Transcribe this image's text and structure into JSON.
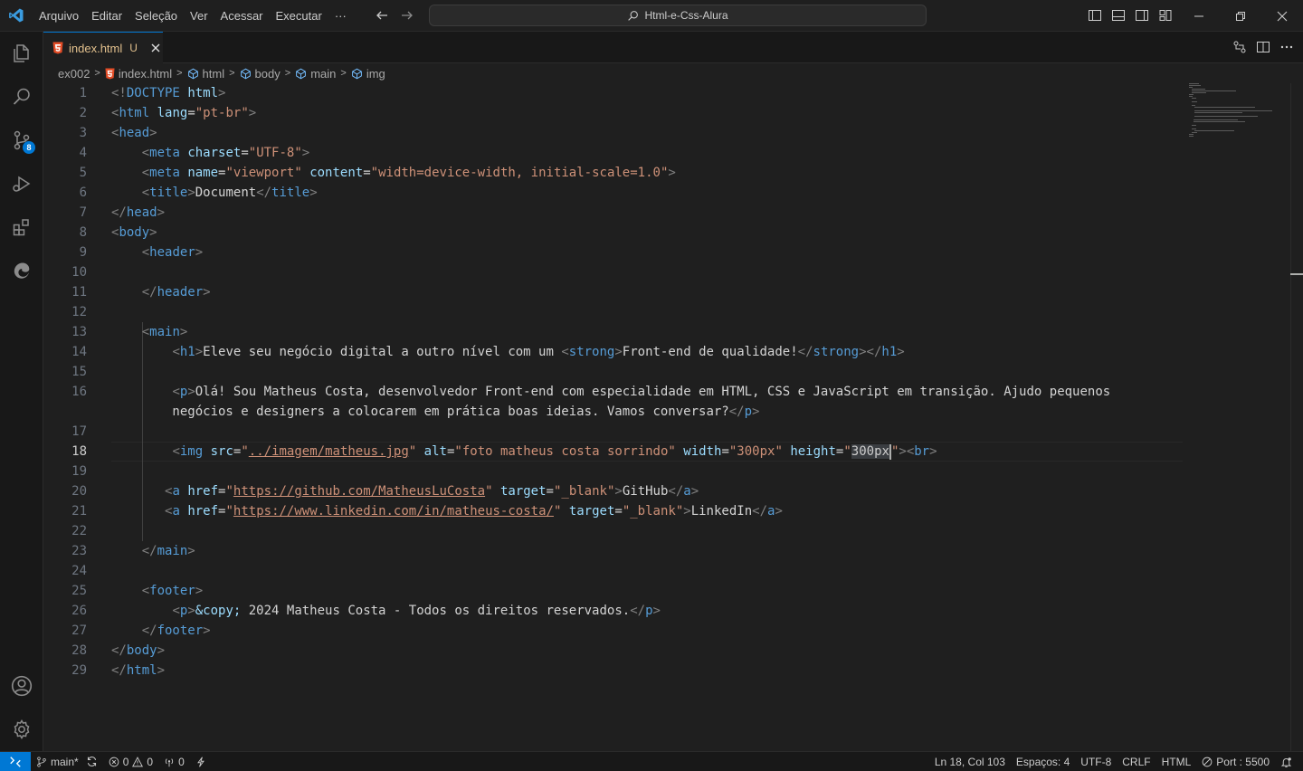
{
  "title_bar": {
    "menu": [
      "Arquivo",
      "Editar",
      "Seleção",
      "Ver",
      "Acessar",
      "Executar"
    ],
    "more": "···",
    "search_text": "Html-e-Css-Alura"
  },
  "activity_bar": {
    "items": [
      "explorer-icon",
      "search-icon",
      "source-control-icon",
      "run-debug-icon",
      "extensions-icon",
      "edge-devtools-icon"
    ],
    "source_control_badge": "8",
    "bottom": [
      "account-icon",
      "settings-icon"
    ]
  },
  "tab": {
    "filename": "index.html",
    "status": "U",
    "icon": "html5-icon"
  },
  "breadcrumb": {
    "items": [
      "ex002",
      "index.html",
      "html",
      "body",
      "main",
      "img"
    ]
  },
  "editor": {
    "active_line": 18,
    "line_numbers": [
      "1",
      "2",
      "3",
      "4",
      "5",
      "6",
      "7",
      "8",
      "9",
      "10",
      "11",
      "12",
      "13",
      "14",
      "15",
      "16",
      "",
      "17",
      "18",
      "19",
      "20",
      "21",
      "22",
      "23",
      "24",
      "25",
      "26",
      "27",
      "28",
      "29"
    ],
    "lines": [
      [
        [
          "t",
          "<!"
        ],
        [
          "tg",
          "DOCTYPE"
        ],
        [
          "tx",
          " "
        ],
        [
          "at",
          "html"
        ],
        [
          "t",
          ">"
        ]
      ],
      [
        [
          "t",
          "<"
        ],
        [
          "tg",
          "html"
        ],
        [
          "tx",
          " "
        ],
        [
          "at",
          "lang"
        ],
        [
          "tx",
          "="
        ],
        [
          "sv",
          "\"pt-br\""
        ],
        [
          "t",
          ">"
        ]
      ],
      [
        [
          "t",
          "<"
        ],
        [
          "tg",
          "head"
        ],
        [
          "t",
          ">"
        ]
      ],
      [
        [
          "tx",
          "    "
        ],
        [
          "t",
          "<"
        ],
        [
          "tg",
          "meta"
        ],
        [
          "tx",
          " "
        ],
        [
          "at",
          "charset"
        ],
        [
          "tx",
          "="
        ],
        [
          "sv",
          "\"UTF-8\""
        ],
        [
          "t",
          ">"
        ]
      ],
      [
        [
          "tx",
          "    "
        ],
        [
          "t",
          "<"
        ],
        [
          "tg",
          "meta"
        ],
        [
          "tx",
          " "
        ],
        [
          "at",
          "name"
        ],
        [
          "tx",
          "="
        ],
        [
          "sv",
          "\"viewport\""
        ],
        [
          "tx",
          " "
        ],
        [
          "at",
          "content"
        ],
        [
          "tx",
          "="
        ],
        [
          "sv",
          "\"width=device-width, initial-scale=1.0\""
        ],
        [
          "t",
          ">"
        ]
      ],
      [
        [
          "tx",
          "    "
        ],
        [
          "t",
          "<"
        ],
        [
          "tg",
          "title"
        ],
        [
          "t",
          ">"
        ],
        [
          "tx",
          "Document"
        ],
        [
          "t",
          "</"
        ],
        [
          "tg",
          "title"
        ],
        [
          "t",
          ">"
        ]
      ],
      [
        [
          "t",
          "</"
        ],
        [
          "tg",
          "head"
        ],
        [
          "t",
          ">"
        ]
      ],
      [
        [
          "t",
          "<"
        ],
        [
          "tg",
          "body"
        ],
        [
          "t",
          ">"
        ]
      ],
      [
        [
          "tx",
          "    "
        ],
        [
          "t",
          "<"
        ],
        [
          "tg",
          "header"
        ],
        [
          "t",
          ">"
        ]
      ],
      [],
      [
        [
          "tx",
          "    "
        ],
        [
          "t",
          "</"
        ],
        [
          "tg",
          "header"
        ],
        [
          "t",
          ">"
        ]
      ],
      [],
      [
        [
          "tx",
          "    "
        ],
        [
          "t",
          "<"
        ],
        [
          "tg",
          "main"
        ],
        [
          "t",
          ">"
        ]
      ],
      [
        [
          "tx",
          "        "
        ],
        [
          "t",
          "<"
        ],
        [
          "tg",
          "h1"
        ],
        [
          "t",
          ">"
        ],
        [
          "tx",
          "Eleve seu negócio digital a outro nível com um "
        ],
        [
          "t",
          "<"
        ],
        [
          "tg",
          "strong"
        ],
        [
          "t",
          ">"
        ],
        [
          "tx",
          "Front-end de qualidade!"
        ],
        [
          "t",
          "</"
        ],
        [
          "tg",
          "strong"
        ],
        [
          "t",
          "></"
        ],
        [
          "tg",
          "h1"
        ],
        [
          "t",
          ">"
        ]
      ],
      [],
      [
        [
          "tx",
          "        "
        ],
        [
          "t",
          "<"
        ],
        [
          "tg",
          "p"
        ],
        [
          "t",
          ">"
        ],
        [
          "tx",
          "Olá! Sou Matheus Costa, desenvolvedor Front-end com especialidade em HTML, CSS e JavaScript em transição. Ajudo pequenos"
        ]
      ],
      [
        [
          "tx",
          "        negócios e designers a colocarem em prática boas ideias. Vamos conversar?"
        ],
        [
          "t",
          "</"
        ],
        [
          "tg",
          "p"
        ],
        [
          "t",
          ">"
        ]
      ],
      [],
      [
        [
          "tx",
          "        "
        ],
        [
          "t",
          "<"
        ],
        [
          "tg",
          "img"
        ],
        [
          "tx",
          " "
        ],
        [
          "at",
          "src"
        ],
        [
          "tx",
          "="
        ],
        [
          "sv",
          "\""
        ],
        [
          "lk",
          "../imagem/matheus.jpg"
        ],
        [
          "sv",
          "\""
        ],
        [
          "tx",
          " "
        ],
        [
          "at",
          "alt"
        ],
        [
          "tx",
          "="
        ],
        [
          "sv",
          "\"foto matheus costa sorrindo\""
        ],
        [
          "tx",
          " "
        ],
        [
          "at",
          "width"
        ],
        [
          "tx",
          "="
        ],
        [
          "sv",
          "\"300px\""
        ],
        [
          "tx",
          " "
        ],
        [
          "at",
          "height"
        ],
        [
          "tx",
          "="
        ],
        [
          "sv",
          "\""
        ],
        [
          "sel",
          "300px"
        ],
        [
          "caret",
          ""
        ],
        [
          "sv",
          "\""
        ],
        [
          "t",
          ">"
        ],
        [
          "t",
          "<"
        ],
        [
          "tg",
          "br"
        ],
        [
          "t",
          ">"
        ]
      ],
      [],
      [
        [
          "tx",
          "       "
        ],
        [
          "t",
          "<"
        ],
        [
          "tg",
          "a"
        ],
        [
          "tx",
          " "
        ],
        [
          "at",
          "href"
        ],
        [
          "tx",
          "="
        ],
        [
          "sv",
          "\""
        ],
        [
          "lk",
          "https://github.com/MatheusLuCosta"
        ],
        [
          "sv",
          "\""
        ],
        [
          "tx",
          " "
        ],
        [
          "at",
          "target"
        ],
        [
          "tx",
          "="
        ],
        [
          "sv",
          "\"_blank\""
        ],
        [
          "t",
          ">"
        ],
        [
          "tx",
          "GitHub"
        ],
        [
          "t",
          "</"
        ],
        [
          "tg",
          "a"
        ],
        [
          "t",
          ">"
        ]
      ],
      [
        [
          "tx",
          "       "
        ],
        [
          "t",
          "<"
        ],
        [
          "tg",
          "a"
        ],
        [
          "tx",
          " "
        ],
        [
          "at",
          "href"
        ],
        [
          "tx",
          "="
        ],
        [
          "sv",
          "\""
        ],
        [
          "lk",
          "https://www.linkedin.com/in/matheus-costa/"
        ],
        [
          "sv",
          "\""
        ],
        [
          "tx",
          " "
        ],
        [
          "at",
          "target"
        ],
        [
          "tx",
          "="
        ],
        [
          "sv",
          "\"_blank\""
        ],
        [
          "t",
          ">"
        ],
        [
          "tx",
          "LinkedIn"
        ],
        [
          "t",
          "</"
        ],
        [
          "tg",
          "a"
        ],
        [
          "t",
          ">"
        ]
      ],
      [],
      [
        [
          "tx",
          "    "
        ],
        [
          "t",
          "</"
        ],
        [
          "tg",
          "main"
        ],
        [
          "t",
          ">"
        ]
      ],
      [],
      [
        [
          "tx",
          "    "
        ],
        [
          "t",
          "<"
        ],
        [
          "tg",
          "footer"
        ],
        [
          "t",
          ">"
        ]
      ],
      [
        [
          "tx",
          "        "
        ],
        [
          "t",
          "<"
        ],
        [
          "tg",
          "p"
        ],
        [
          "t",
          ">"
        ],
        [
          "at",
          "&copy;"
        ],
        [
          "tx",
          " 2024 Matheus Costa - Todos os direitos reservados."
        ],
        [
          "t",
          "</"
        ],
        [
          "tg",
          "p"
        ],
        [
          "t",
          ">"
        ]
      ],
      [
        [
          "tx",
          "    "
        ],
        [
          "t",
          "</"
        ],
        [
          "tg",
          "footer"
        ],
        [
          "t",
          ">"
        ]
      ],
      [
        [
          "t",
          "</"
        ],
        [
          "tg",
          "body"
        ],
        [
          "t",
          ">"
        ]
      ],
      [
        [
          "t",
          "</"
        ],
        [
          "tg",
          "html"
        ],
        [
          "t",
          ">"
        ]
      ]
    ]
  },
  "status_bar": {
    "branch": "main*",
    "errors": "0",
    "warnings": "0",
    "ports": "0",
    "position": "Ln 18, Col 103",
    "spaces": "Espaços: 4",
    "encoding": "UTF-8",
    "eol": "CRLF",
    "language": "HTML",
    "port": "Port : 5500"
  },
  "colors": {
    "accent": "#0078d4",
    "tag": "#569cd6",
    "attribute": "#9cdcfe",
    "string": "#ce9178",
    "modified": "#e2c08d"
  }
}
